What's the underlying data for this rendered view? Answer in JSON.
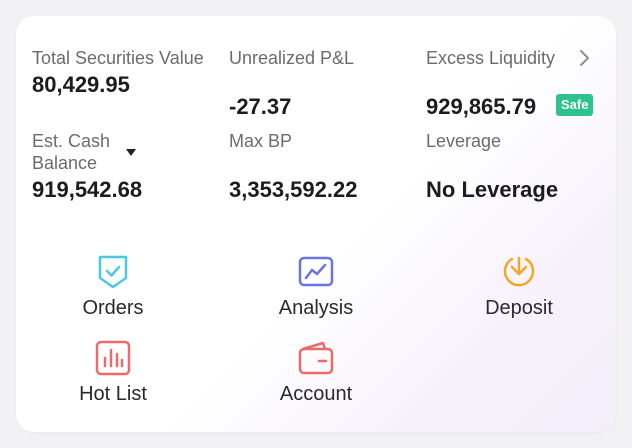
{
  "metrics": {
    "total_securities_value": {
      "label": "Total Securities Value",
      "value": "80,429.95"
    },
    "unrealized_pnl": {
      "label": "Unrealized P&L",
      "value": "-27.37"
    },
    "excess_liquidity": {
      "label": "Excess Liquidity",
      "value": "929,865.79",
      "badge": "Safe"
    },
    "est_cash_balance": {
      "label": "Est. Cash Balance",
      "value": "919,542.68"
    },
    "max_bp": {
      "label": "Max BP",
      "value": "3,353,592.22"
    },
    "leverage": {
      "label": "Leverage",
      "value": "No Leverage"
    }
  },
  "actions": [
    {
      "label": "Orders",
      "icon": "orders-icon",
      "color": "#4ec8de"
    },
    {
      "label": "Analysis",
      "icon": "analysis-icon",
      "color": "#6b74e0"
    },
    {
      "label": "Deposit",
      "icon": "deposit-icon",
      "color": "#f5a623"
    },
    {
      "label": "Hot List",
      "icon": "hot-list-icon",
      "color": "#ee6a6a"
    },
    {
      "label": "Account",
      "icon": "account-icon",
      "color": "#ee6a6a"
    }
  ],
  "colors": {
    "safe_badge": "#2ec28d",
    "value_text": "#1c1c1e",
    "label_text": "#6b6b70"
  }
}
